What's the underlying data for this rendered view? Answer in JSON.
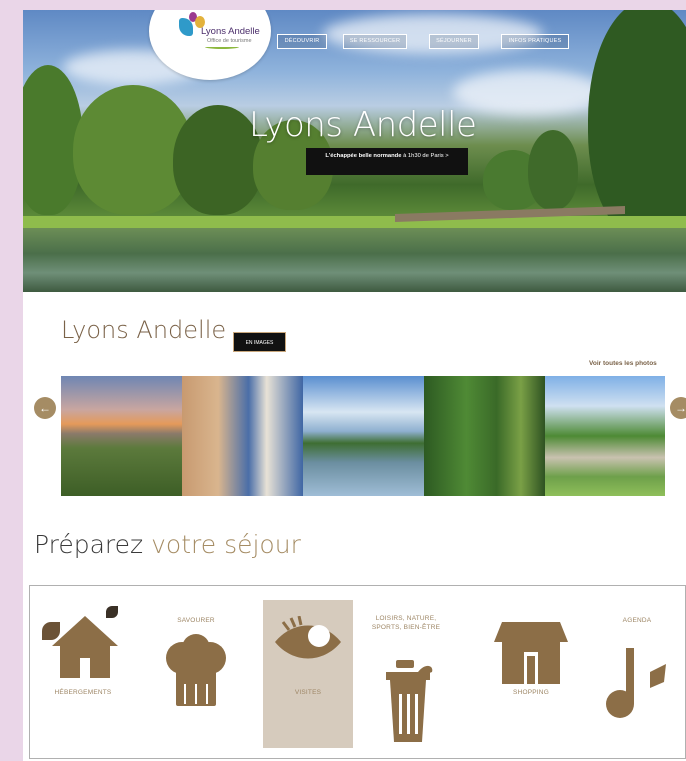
{
  "header": {
    "logo": {
      "name": "Lyons Andelle",
      "subtitle": "Office de tourisme"
    },
    "nav": [
      "DÉCOUVRIR",
      "SE RESSOURCER",
      "SÉJOURNER",
      "INFOS PRATIQUES"
    ],
    "hero_title": "Lyons Andelle",
    "tagline_bold": "L'échappée belle normande",
    "tagline_rest": "à 1h30 de Paris",
    "tagline_arrow": ">"
  },
  "gallery": {
    "title": "Lyons Andelle",
    "badge": "EN IMAGES",
    "see_all": "Voir toutes les photos",
    "prev_icon": "arrow-left-icon",
    "next_icon": "arrow-right-icon"
  },
  "sejour": {
    "title_main": "Préparez",
    "title_accent": "votre séjour",
    "categories": [
      {
        "label": "HÉBERGEMENTS",
        "icon": "house-icon"
      },
      {
        "label": "SAVOURER",
        "icon": "chef-hat-icon"
      },
      {
        "label": "VISITES",
        "icon": "eye-icon"
      },
      {
        "label": "LOISIRS, NATURE, SPORTS, BIEN-ÊTRE",
        "icon": "bucket-icon"
      },
      {
        "label": "SHOPPING",
        "icon": "shop-icon"
      },
      {
        "label": "AGENDA",
        "icon": "music-note-icon"
      }
    ]
  },
  "colors": {
    "accent": "#a58c64",
    "brown": "#8c6e47",
    "background": "#ead6e8"
  }
}
